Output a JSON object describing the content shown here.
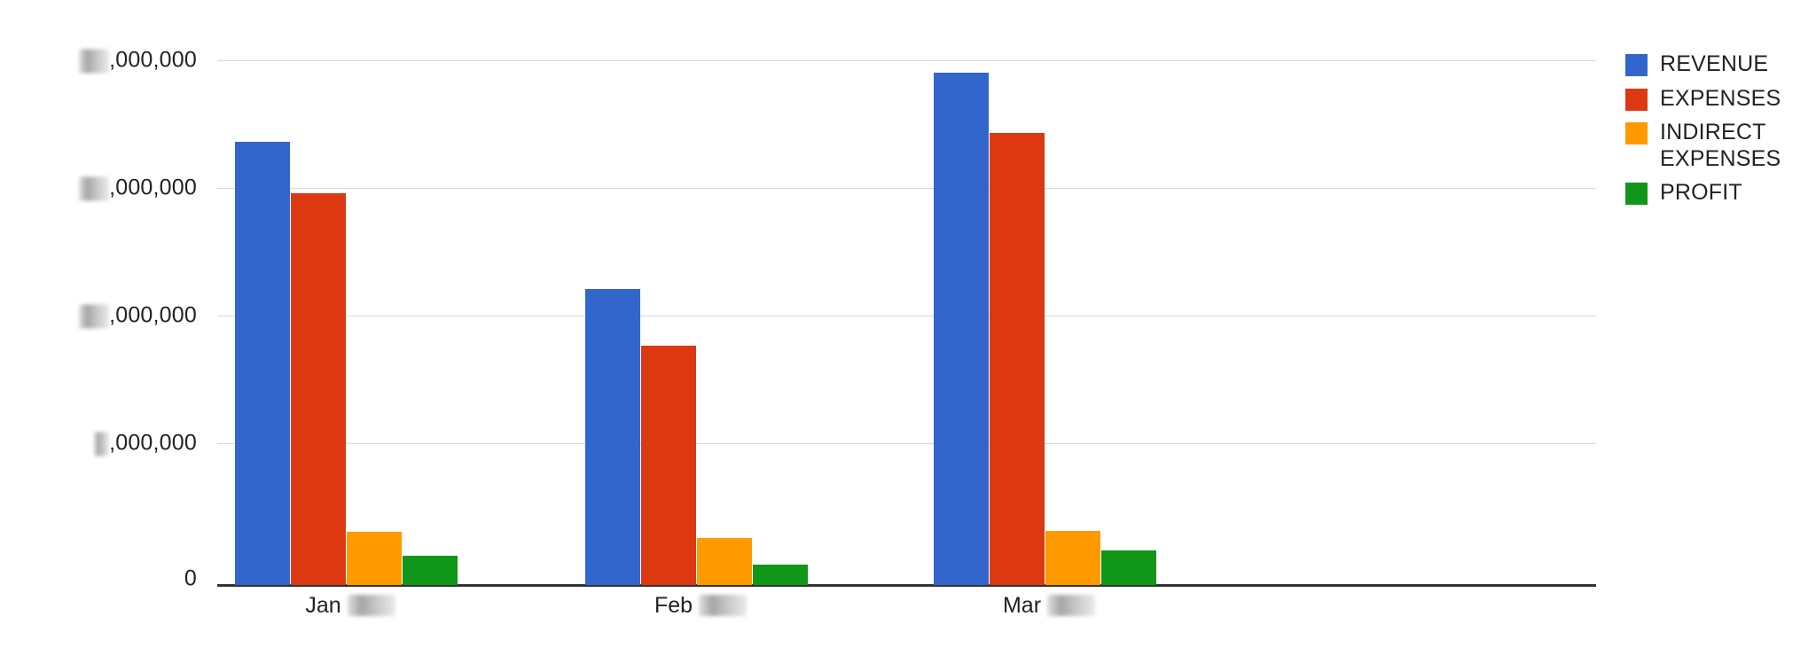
{
  "chart_data": {
    "type": "bar",
    "title": "",
    "subtitle": "",
    "xlabel": "",
    "ylabel": "",
    "grid": true,
    "legend_position": "right",
    "categories": [
      "Jan ████",
      "Feb ████",
      "Mar ████"
    ],
    "category_months": [
      "Jan",
      "Feb",
      "Mar"
    ],
    "category_year_redacted": true,
    "ylim": [
      0,
      4250000
    ],
    "ytick_values": [
      0,
      1000000,
      2000000,
      3000000,
      4000000
    ],
    "ytick_labels": [
      "0",
      "█,000,000",
      "██,000,000",
      "██,000,000",
      "██,000,000"
    ],
    "ytick_redacted": [
      false,
      true,
      true,
      true,
      true
    ],
    "series": [
      {
        "name": "REVENUE",
        "color": "#3366cc",
        "values": [
          3450000,
          2300000,
          3980000
        ]
      },
      {
        "name": "EXPENSES",
        "color": "#dc3912",
        "values": [
          3050000,
          1870000,
          3500000
        ]
      },
      {
        "name": "INDIRECT EXPENSES",
        "color": "#ff9900",
        "values": [
          420000,
          370000,
          420000
        ]
      },
      {
        "name": "PROFIT",
        "color": "#109618",
        "values": [
          230000,
          160000,
          270000
        ]
      }
    ]
  },
  "legend": {
    "items": [
      {
        "label": "REVENUE",
        "color": "#3366cc"
      },
      {
        "label": "EXPENSES",
        "color": "#dc3912"
      },
      {
        "label": "INDIRECT EXPENSES",
        "color": "#ff9900"
      },
      {
        "label": "PROFIT",
        "color": "#109618"
      }
    ]
  },
  "axis": {
    "y_labels": [
      {
        "text": ",000,000",
        "redact_digits": 2
      },
      {
        "text": ",000,000",
        "redact_digits": 2
      },
      {
        "text": ",000,000",
        "redact_digits": 2
      },
      {
        "text": ",000,000",
        "redact_digits": 1
      },
      {
        "text": "0",
        "redact_digits": 0
      }
    ],
    "x_labels": [
      {
        "month": "Jan",
        "year_redacted": true
      },
      {
        "month": "Feb",
        "year_redacted": true
      },
      {
        "month": "Mar",
        "year_redacted": true
      }
    ]
  }
}
